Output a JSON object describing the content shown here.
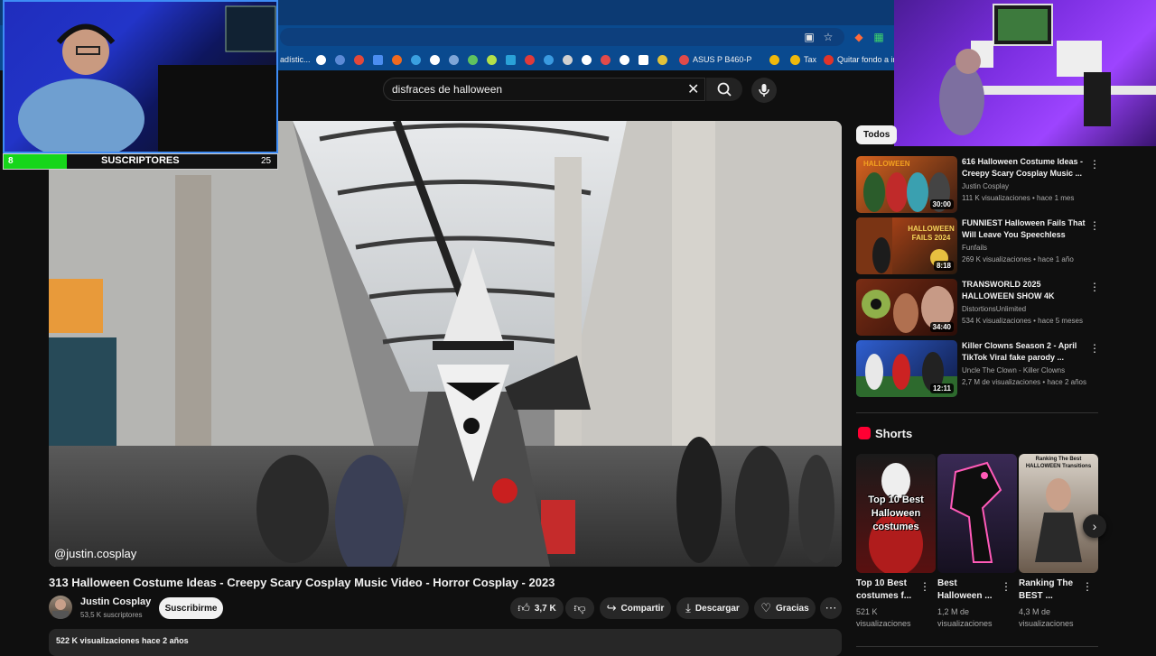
{
  "bookmarks": [
    "adístic...",
    "ASUS P B460-P",
    "Tax",
    "Quitar fondo a im"
  ],
  "search": {
    "query": "disfraces de halloween"
  },
  "overlay": {
    "sub_count_left": "8",
    "sub_label": "SUSCRIPTORES",
    "sub_count_right": "25",
    "sub_progress": 0.23
  },
  "video": {
    "handle": "@justin.cosplay",
    "title": "313 Halloween Costume Ideas - Creepy Scary Cosplay Music Video - Horror Cosplay - 2023",
    "channel": "Justin Cosplay",
    "channel_subs": "53,5 K suscriptores",
    "subscribe_label": "Suscribirme",
    "likes": "3,7 K",
    "share_label": "Compartir",
    "download_label": "Descargar",
    "thanks_label": "Gracias",
    "description_meta": "522 K visualizaciones  hace 2 años"
  },
  "filters": {
    "all": "Todos"
  },
  "recommendations": [
    {
      "title": "616 Halloween Costume Ideas - Creepy Scary Cosplay Music ...",
      "channel": "Justin Cosplay",
      "meta": "111 K visualizaciones • hace 1 mes",
      "duration": "30:00",
      "thumb_colors": [
        "#d6631f",
        "#3c1d12"
      ],
      "thumb_text": "HALLOWEEN"
    },
    {
      "title": "FUNNIEST Halloween Fails That Will Leave You Speechless",
      "channel": "Funfails",
      "meta": "269 K visualizaciones • hace 1 año",
      "duration": "8:18",
      "thumb_colors": [
        "#c74c1a",
        "#2b1a0e"
      ],
      "thumb_text": "HALLOWEEN FAILS 2024"
    },
    {
      "title": "TRANSWORLD 2025 HALLOWEEN SHOW 4K",
      "channel": "DistortionsUnlimited",
      "meta": "534 K visualizaciones • hace 5 meses",
      "duration": "34:40",
      "thumb_colors": [
        "#7a2d14",
        "#2a0d08"
      ],
      "thumb_text": ""
    },
    {
      "title": "Killer Clowns Season 2 - April TikTok Viral fake parody ...",
      "channel": "Uncle The Clown - Killer Clowns",
      "meta": "2,7 M de visualizaciones • hace 2 años",
      "duration": "12:11",
      "thumb_colors": [
        "#2f5fd0",
        "#0f1a44"
      ],
      "thumb_text": ""
    }
  ],
  "shorts": {
    "heading": "Shorts",
    "items": [
      {
        "title": "Top 10 Best costumes f...",
        "views": "521 K visualizaciones",
        "overlay": "Top 10 Best Halloween costumes",
        "colors": [
          "#1a1a1a",
          "#5a1010"
        ]
      },
      {
        "title": "Best Halloween ...",
        "views": "1,2 M de visualizaciones",
        "overlay": "",
        "colors": [
          "#3a2a55",
          "#15101f"
        ]
      },
      {
        "title": "Ranking The BEST ...",
        "views": "4,3 M de visualizaciones",
        "overlay": "Ranking The Best HALLOWEEN Transitions",
        "colors": [
          "#d9d2c8",
          "#6a5a4c"
        ]
      }
    ]
  }
}
